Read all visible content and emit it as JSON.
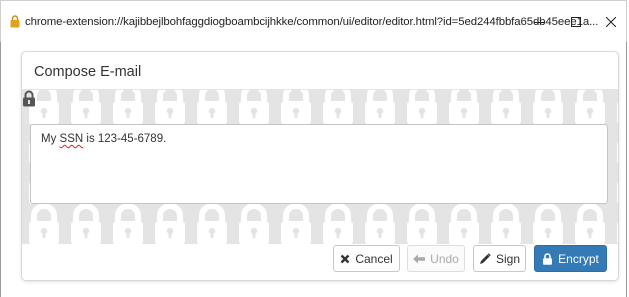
{
  "window": {
    "url": "chrome-extension://kajibbejlbohfaggdiogboambcijhkke/common/ui/editor/editor.html?id=5ed244fbbfa65db45eee1a...",
    "controls": {
      "minimize": "—",
      "maximize": "☐",
      "close": "✕"
    }
  },
  "dialog": {
    "title": "Compose E-mail",
    "body": {
      "text_prefix": "My ",
      "misspelled": "SSN",
      "text_suffix": " is 123-45-6789."
    },
    "buttons": {
      "cancel": "Cancel",
      "undo": "Undo",
      "sign": "Sign",
      "encrypt": "Encrypt"
    }
  },
  "icons": {
    "address_lock": "padlock-icon",
    "corner_lock": "padlock-icon",
    "cancel": "x-icon",
    "undo": "arrow-left-icon",
    "sign": "pen-icon",
    "encrypt": "lock-icon"
  },
  "colors": {
    "primary": "#337ab7",
    "pattern_background": "#e4e4e4",
    "pattern_locks": "#ffffff",
    "address_lock": "#e0a21e"
  }
}
